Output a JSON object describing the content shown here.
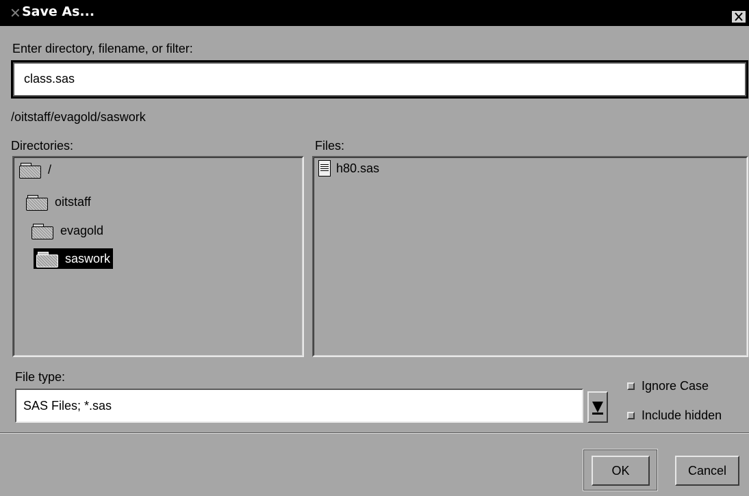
{
  "window": {
    "title": "Save As..."
  },
  "entry": {
    "label": "Enter directory, filename, or filter:",
    "value": "class.sas"
  },
  "current_path": "/oitstaff/evagold/saswork",
  "directories": {
    "label": "Directories:",
    "items": [
      {
        "label": "/",
        "selected": false
      },
      {
        "label": "oitstaff",
        "selected": false
      },
      {
        "label": "evagold",
        "selected": false
      },
      {
        "label": "saswork",
        "selected": true
      }
    ]
  },
  "files": {
    "label": "Files:",
    "items": [
      {
        "label": "h80.sas",
        "icon": "document-icon"
      }
    ]
  },
  "file_type": {
    "label": "File type:",
    "selected": "SAS Files; *.sas"
  },
  "options": {
    "ignore_case": "Ignore Case",
    "include_hidden": "Include hidden"
  },
  "buttons": {
    "ok": "OK",
    "cancel": "Cancel"
  }
}
